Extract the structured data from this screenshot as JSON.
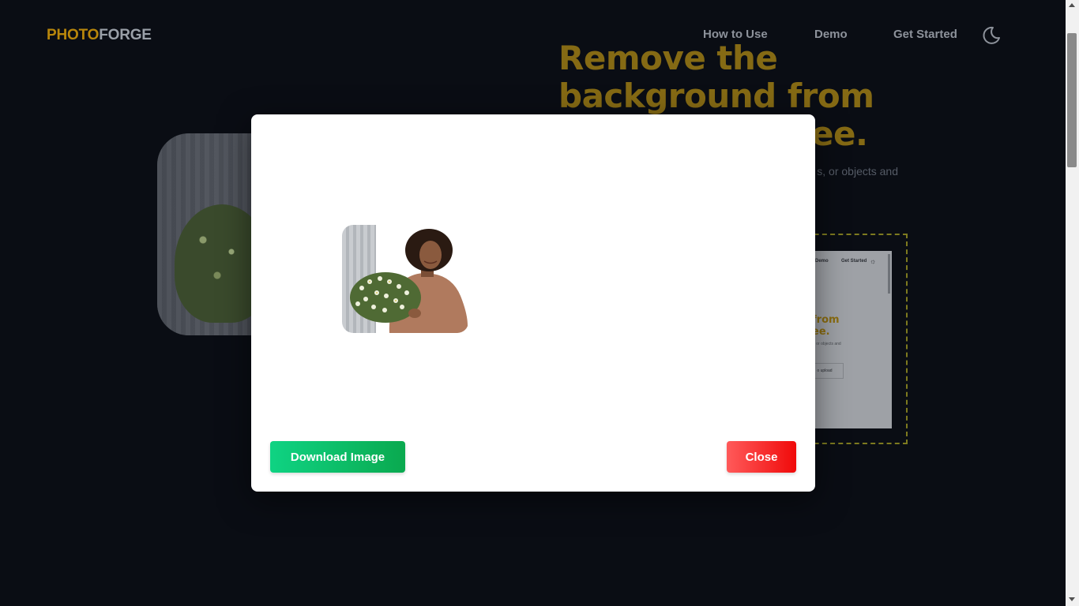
{
  "header": {
    "logo_part1": "PHOTO",
    "logo_part2": "FORGE",
    "nav": [
      "How to Use",
      "Demo",
      "Get Started"
    ],
    "theme_toggle_icon": "moon-icon"
  },
  "hero": {
    "title": "Remove the background from",
    "title_visible_end": "ee.",
    "subtitle_visible": "s, or objects and"
  },
  "preview": {
    "nav_demo": "Demo",
    "nav_get_started": "Get Started",
    "theme_icon": "sun-icon",
    "title_line1": "from",
    "title_line2": "ee.",
    "subtitle": "s, or objects and",
    "upload_label": "o upload"
  },
  "modal": {
    "download_label": "Download Image",
    "close_label": "Close"
  },
  "colors": {
    "background": "#0a0d14",
    "brand_gold": "#b8860b",
    "download_green": "#0aa94f",
    "close_red": "#f00a0a"
  }
}
